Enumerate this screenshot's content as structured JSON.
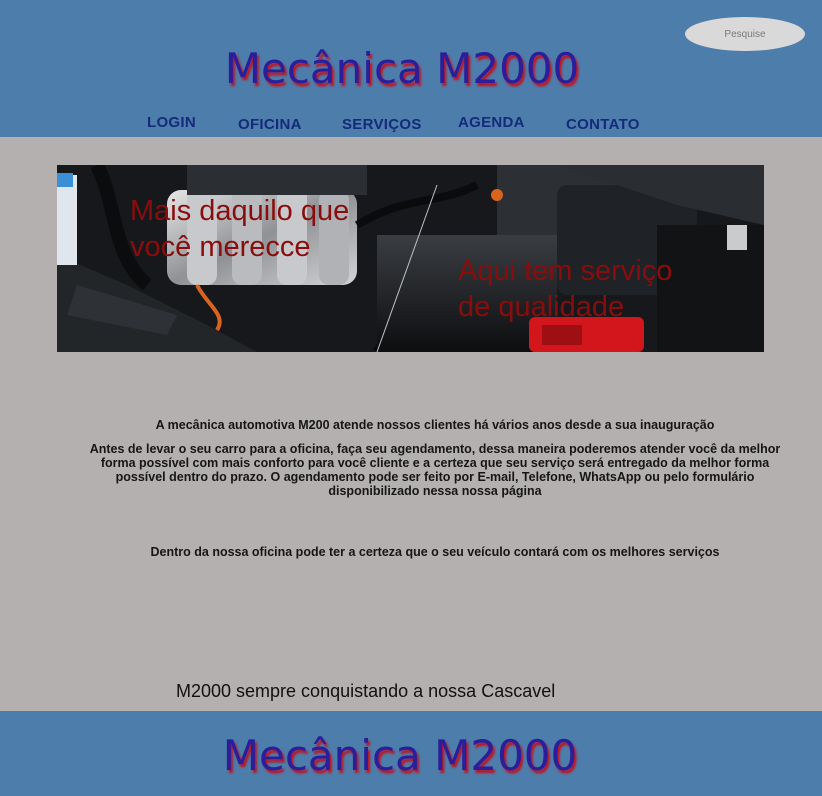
{
  "header": {
    "brand": "Mecânica M2000",
    "search_placeholder": "Pesquise",
    "nav": [
      {
        "label": "LOGIN"
      },
      {
        "label": "OFICINA"
      },
      {
        "label": "SERVIÇOS"
      },
      {
        "label": "AGENDA"
      },
      {
        "label": "CONTATO"
      }
    ]
  },
  "banner": {
    "image_icon": "car-engine-image",
    "text_left_1": "Mais daquilo que",
    "text_left_2": "você merecce",
    "text_right_1": "Aqui tem serviço",
    "text_right_2": "de qualidade"
  },
  "content": {
    "intro": "A mecânica automotiva M200 atende nossos clientes há vários anos desde a sua inauguração",
    "scheduling": "Antes de levar o seu carro para a oficina, faça seu agendamento, dessa maneira poderemos atender você da melhor forma possível com mais conforto para você cliente e a certeza que seu serviço será entregado da melhor forma possível dentro do prazo. O agendamento pode ser feito por E-mail, Telefone, WhatsApp ou pelo formulário disponibilizado nessa nossa página",
    "services": "Dentro da nossa oficina pode ter a certeza que o seu veículo contará com os melhores serviços",
    "slogan": "M2000 sempre conquistando a nossa Cascavel"
  },
  "footer": {
    "brand": "Mecânica M2000"
  },
  "colors": {
    "header_bg": "#4d7dab",
    "page_bg": "#b3b0af",
    "brand_text": "#2a1e9a",
    "brand_shadow": "#c1121f",
    "nav_text": "#152a7a",
    "banner_text": "#8a0d0d"
  }
}
